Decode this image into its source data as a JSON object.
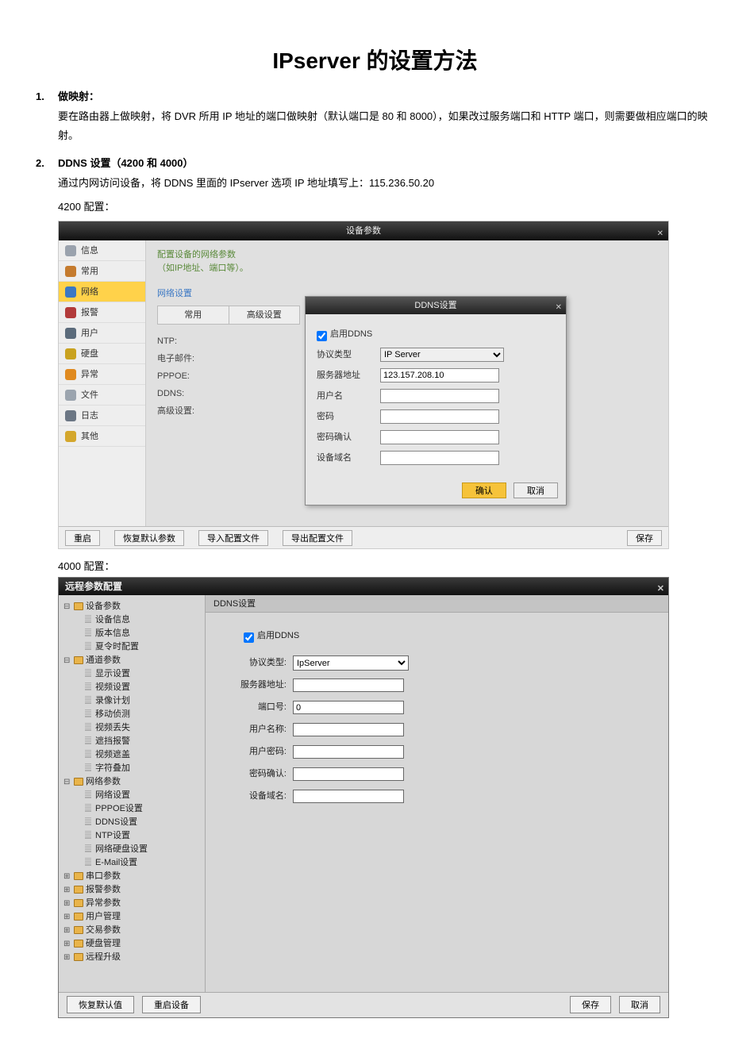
{
  "doc": {
    "title": "IPserver 的设置方法",
    "items": [
      {
        "num": "1.",
        "heading": "做映射：",
        "body": "要在路由器上做映射，将 DVR 所用 IP 地址的端口做映射（默认端口是 80 和 8000），如果改过服务端口和 HTTP 端口，则需要做相应端口的映射。"
      },
      {
        "num": "2.",
        "heading": "DDNS 设置（4200 和 4000）",
        "body": "通过内网访问设备，将 DDNS 里面的 IPserver 选项 IP 地址填写上：115.236.50.20"
      }
    ],
    "label_4200": "4200 配置：",
    "label_4000": "4000 配置："
  },
  "shot4200": {
    "window_title": "设备参数",
    "sidebar": [
      {
        "label": "信息",
        "icon": "#9aa2ad"
      },
      {
        "label": "常用",
        "icon": "#c57b2e"
      },
      {
        "label": "网络",
        "icon": "#3b78c4",
        "active": true
      },
      {
        "label": "报警",
        "icon": "#b23a3a"
      },
      {
        "label": "用户",
        "icon": "#5b6b7b"
      },
      {
        "label": "硬盘",
        "icon": "#c9a21f"
      },
      {
        "label": "异常",
        "icon": "#e08a1f"
      },
      {
        "label": "文件",
        "icon": "#9ba4ae"
      },
      {
        "label": "日志",
        "icon": "#6b7684"
      },
      {
        "label": "其他",
        "icon": "#d4a72c"
      }
    ],
    "hint_line1": "配置设备的网络参数",
    "hint_line2": "（如IP地址、端口等）。",
    "section_link": "网络设置",
    "tabs": [
      "常用",
      "高级设置"
    ],
    "left_labels": [
      "NTP:",
      "电子邮件:",
      "PPPOE:",
      "DDNS:",
      "高级设置:"
    ],
    "modal": {
      "title": "DDNS设置",
      "enable_label": "启用DDNS",
      "enable_checked": true,
      "rows": [
        {
          "label": "协议类型",
          "type": "select",
          "value": "IP Server"
        },
        {
          "label": "服务器地址",
          "type": "text",
          "value": "123.157.208.10"
        },
        {
          "label": "用户名",
          "type": "text",
          "value": ""
        },
        {
          "label": "密码",
          "type": "text",
          "value": ""
        },
        {
          "label": "密码确认",
          "type": "text",
          "value": ""
        },
        {
          "label": "设备域名",
          "type": "text",
          "value": ""
        }
      ],
      "btn_ok": "确认",
      "btn_cancel": "取消"
    },
    "bottom": {
      "b1": "重启",
      "b2": "恢复默认参数",
      "b3": "导入配置文件",
      "b4": "导出配置文件",
      "b5": "保存"
    }
  },
  "shot4000": {
    "window_title": "远程参数配置",
    "panel_title": "DDNS设置",
    "enable_label": "启用DDNS",
    "enable_checked": true,
    "fields": [
      {
        "label": "协议类型:",
        "type": "select",
        "value": "IpServer"
      },
      {
        "label": "服务器地址:",
        "type": "text",
        "value": ""
      },
      {
        "label": "端口号:",
        "type": "text",
        "value": "0"
      },
      {
        "label": "用户名称:",
        "type": "text",
        "value": ""
      },
      {
        "label": "用户密码:",
        "type": "text",
        "value": ""
      },
      {
        "label": "密码确认:",
        "type": "text",
        "value": ""
      },
      {
        "label": "设备域名:",
        "type": "text",
        "value": ""
      }
    ],
    "tree": [
      {
        "type": "folder",
        "label": "设备参数",
        "open": true,
        "children": [
          {
            "type": "leaf",
            "label": "设备信息"
          },
          {
            "type": "leaf",
            "label": "版本信息"
          },
          {
            "type": "leaf",
            "label": "夏令时配置"
          }
        ]
      },
      {
        "type": "folder",
        "label": "通道参数",
        "open": true,
        "children": [
          {
            "type": "leaf",
            "label": "显示设置"
          },
          {
            "type": "leaf",
            "label": "视频设置"
          },
          {
            "type": "leaf",
            "label": "录像计划"
          },
          {
            "type": "leaf",
            "label": "移动侦测"
          },
          {
            "type": "leaf",
            "label": "视频丢失"
          },
          {
            "type": "leaf",
            "label": "遮挡报警"
          },
          {
            "type": "leaf",
            "label": "视频遮盖"
          },
          {
            "type": "leaf",
            "label": "字符叠加"
          }
        ]
      },
      {
        "type": "folder",
        "label": "网络参数",
        "open": true,
        "children": [
          {
            "type": "leaf",
            "label": "网络设置"
          },
          {
            "type": "leaf",
            "label": "PPPOE设置"
          },
          {
            "type": "leaf",
            "label": "DDNS设置"
          },
          {
            "type": "leaf",
            "label": "NTP设置"
          },
          {
            "type": "leaf",
            "label": "网络硬盘设置"
          },
          {
            "type": "leaf",
            "label": "E-Mail设置"
          }
        ]
      },
      {
        "type": "folder",
        "label": "串口参数",
        "open": false
      },
      {
        "type": "folder",
        "label": "报警参数",
        "open": false
      },
      {
        "type": "folder",
        "label": "异常参数",
        "open": false
      },
      {
        "type": "folder",
        "label": "用户管理",
        "open": false
      },
      {
        "type": "folder",
        "label": "交易参数",
        "open": false
      },
      {
        "type": "folder",
        "label": "硬盘管理",
        "open": false
      },
      {
        "type": "folder",
        "label": "远程升级",
        "open": false
      }
    ],
    "bottom": {
      "b1": "恢复默认值",
      "b2": "重启设备",
      "b3": "保存",
      "b4": "取消"
    }
  }
}
